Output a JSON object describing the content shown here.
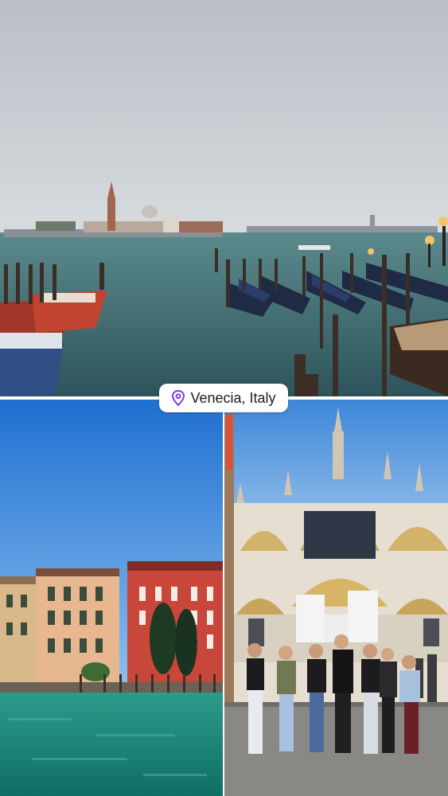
{
  "location_sticker": {
    "text": "Venecia, Italy",
    "icon": "location-pin-icon",
    "icon_color": "#7c3aed"
  },
  "photos": [
    {
      "description_key": "grand-canal-gondolas-san-giorgio"
    },
    {
      "description_key": "canal-buildings"
    },
    {
      "description_key": "st-marks-basilica-group"
    }
  ],
  "colors": {
    "sky_top": "#c7cdd3",
    "water_top": "#3f6b72",
    "sky_blue": "#2a7fd6",
    "canal_green": "#1f8a7a"
  }
}
